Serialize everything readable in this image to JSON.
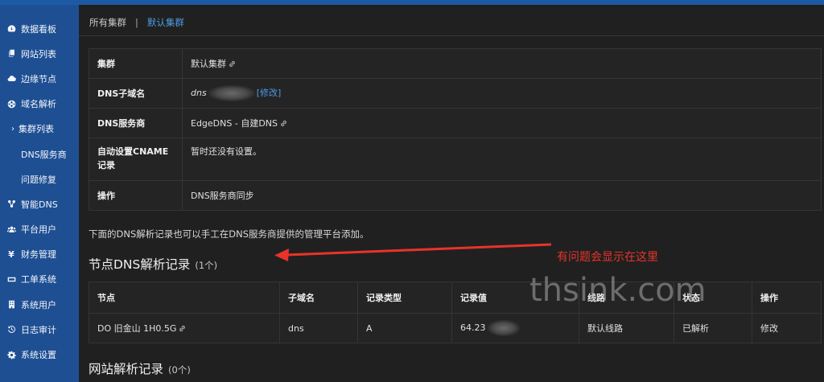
{
  "sidebar": {
    "items": [
      {
        "label": "数据看板",
        "icon": "dashboard-icon"
      },
      {
        "label": "网站列表",
        "icon": "copy-icon"
      },
      {
        "label": "边缘节点",
        "icon": "cloud-icon"
      },
      {
        "label": "域名解析",
        "icon": "globe-icon"
      },
      {
        "label": "集群列表",
        "icon": "chevron-right-icon",
        "active": true
      },
      {
        "label": "DNS服务商"
      },
      {
        "label": "问题修复"
      },
      {
        "label": "智能DNS",
        "icon": "network-icon"
      },
      {
        "label": "平台用户",
        "icon": "users-icon"
      },
      {
        "label": "财务管理",
        "icon": "yen-icon"
      },
      {
        "label": "工单系统",
        "icon": "ticket-icon"
      },
      {
        "label": "系统用户",
        "icon": "building-icon"
      },
      {
        "label": "日志审计",
        "icon": "history-icon"
      },
      {
        "label": "系统设置",
        "icon": "gear-icon"
      }
    ]
  },
  "breadcrumb": {
    "all_clusters": "所有集群",
    "separator": "|",
    "current": "默认集群"
  },
  "info": {
    "cluster_label": "集群",
    "cluster_value": "默认集群",
    "subdomain_label": "DNS子域名",
    "subdomain_prefix": "dns",
    "subdomain_edit": "[修改]",
    "provider_label": "DNS服务商",
    "provider_value": "EdgeDNS - 自建DNS",
    "cname_label": "自动设置CNAME记录",
    "cname_value": "暂时还没有设置。",
    "action_label": "操作",
    "action_value": "DNS服务商同步"
  },
  "note": "下面的DNS解析记录也可以手工在DNS服务商提供的管理平台添加。",
  "node_section": {
    "title": "节点DNS解析记录",
    "count": "(1个)"
  },
  "annotation": "有问题会显示在这里",
  "watermark": "thsink.com",
  "records": {
    "headers": [
      "节点",
      "子域名",
      "记录类型",
      "记录值",
      "线路",
      "状态",
      "操作"
    ],
    "rows": [
      {
        "node": "DO 旧金山 1H0.5G",
        "subdomain": "dns",
        "type": "A",
        "value": "64.23",
        "line": "默认线路",
        "status": "已解析",
        "action": "修改"
      }
    ]
  },
  "site_section": {
    "title": "网站解析记录",
    "count": "(0个)"
  },
  "colors": {
    "sidebar": "#1e4f93",
    "link": "#4d9be0",
    "ok": "#46c05a",
    "annotation": "#e8332a"
  }
}
